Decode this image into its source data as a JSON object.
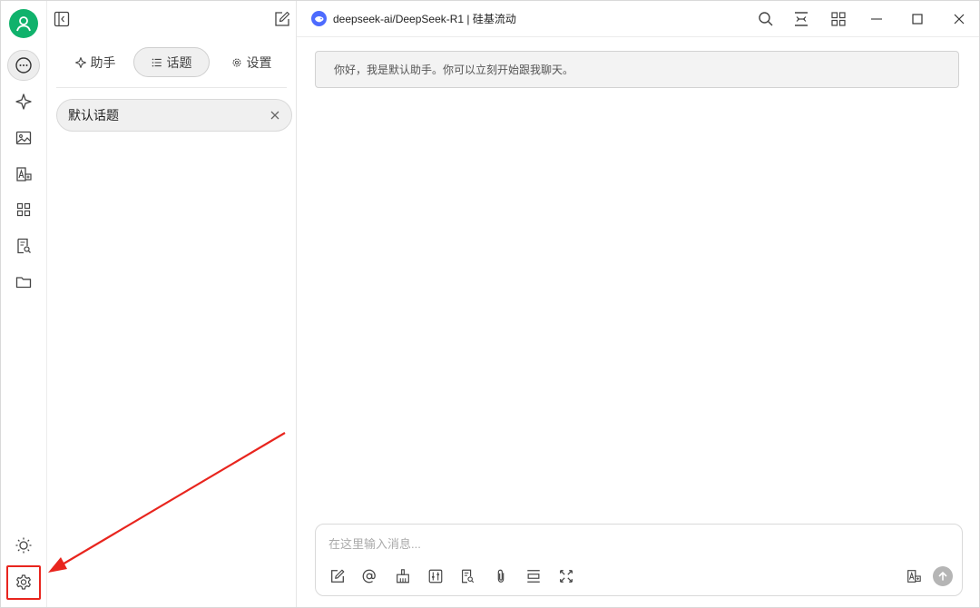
{
  "sidebar_rail": {
    "items": [
      {
        "name": "chat",
        "icon": "chat-bubble-icon",
        "active": true
      },
      {
        "name": "assistant",
        "icon": "sparkle-icon"
      },
      {
        "name": "painting",
        "icon": "image-icon"
      },
      {
        "name": "translate",
        "icon": "translate-icon"
      },
      {
        "name": "apps",
        "icon": "grid-icon"
      },
      {
        "name": "knowledge",
        "icon": "doc-search-icon"
      },
      {
        "name": "files",
        "icon": "folder-icon"
      }
    ],
    "bottom": [
      {
        "name": "theme",
        "icon": "sun-icon"
      },
      {
        "name": "settings",
        "icon": "gear-icon"
      }
    ]
  },
  "panel": {
    "tabs": [
      {
        "label": "助手",
        "icon": "sparkle-icon",
        "active": false
      },
      {
        "label": "话题",
        "icon": "list-icon",
        "active": true
      },
      {
        "label": "设置",
        "icon": "gear-icon",
        "active": false
      }
    ],
    "topics": [
      {
        "label": "默认话题"
      }
    ]
  },
  "main": {
    "model_label": "deepseek-ai/DeepSeek-R1 | 硅基流动",
    "greeting": "你好，我是默认助手。你可以立刻开始跟我聊天。",
    "composer": {
      "placeholder": "在这里输入消息...",
      "value": "",
      "tools": [
        "edit-icon",
        "at-icon",
        "broom-icon",
        "sliders-icon",
        "doc-search-icon",
        "paperclip-icon",
        "expand-vertical-icon",
        "fullscreen-icon"
      ]
    }
  },
  "colors": {
    "avatar": "#10b26c",
    "highlight": "#e8251e",
    "model_logo": "#4d6bfe"
  }
}
